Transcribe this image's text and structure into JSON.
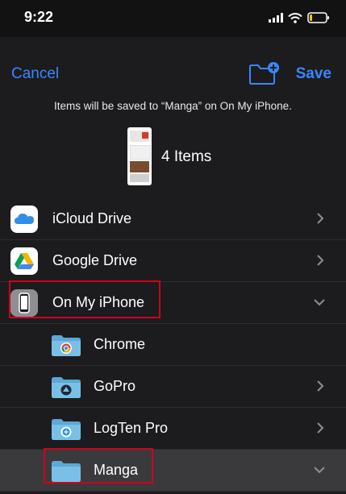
{
  "status": {
    "time": "9:22"
  },
  "nav": {
    "cancel": "Cancel",
    "save": "Save"
  },
  "info": "Items will be saved to “Manga” on On My iPhone.",
  "items_count": "4 Items",
  "locations": [
    {
      "label": "iCloud Drive",
      "icon": "icloud-icon",
      "accessory": "chevron-right"
    },
    {
      "label": "Google Drive",
      "icon": "google-drive-icon",
      "accessory": "chevron-right"
    },
    {
      "label": "On My iPhone",
      "icon": "iphone-icon",
      "accessory": "chevron-down",
      "highlighted": true
    }
  ],
  "folders": [
    {
      "label": "Chrome",
      "icon": "chrome-folder-icon",
      "accessory": "none"
    },
    {
      "label": "GoPro",
      "icon": "gopro-folder-icon",
      "accessory": "chevron-right"
    },
    {
      "label": "LogTen Pro",
      "icon": "logten-folder-icon",
      "accessory": "chevron-right"
    },
    {
      "label": "Manga",
      "icon": "folder-icon",
      "accessory": "chevron-down",
      "selected": true,
      "highlighted": true
    }
  ],
  "colors": {
    "accent": "#3a86ff",
    "background": "#1c1c1e",
    "selected_row": "#3a3a3c",
    "highlight_outline": "#d0021b"
  }
}
